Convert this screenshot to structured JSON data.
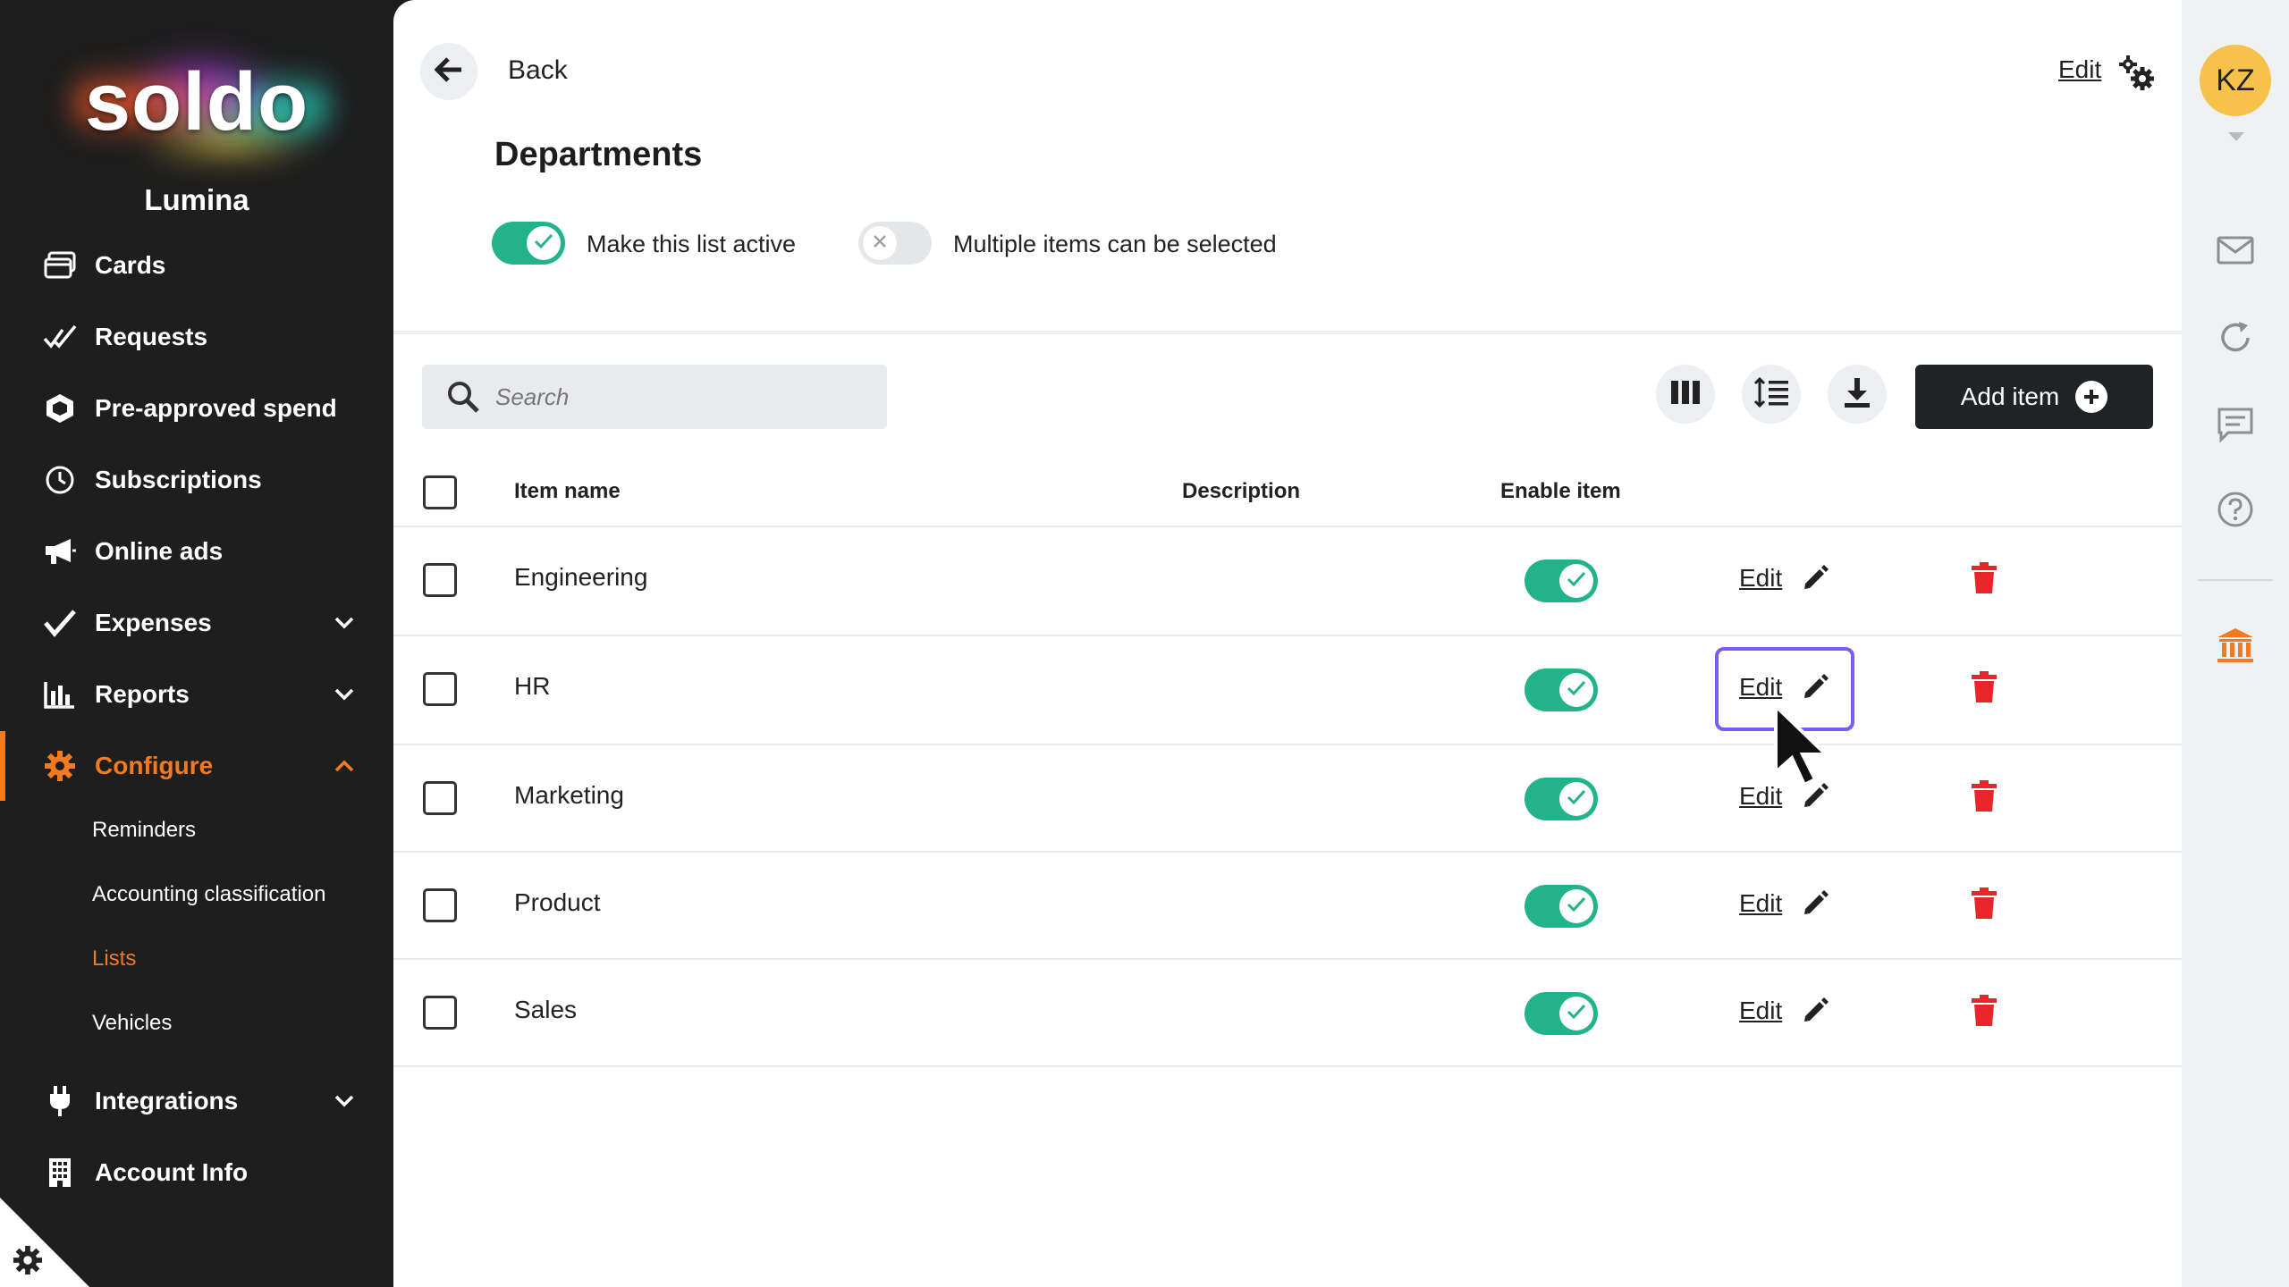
{
  "sidebar": {
    "logo_text": "soldo",
    "company": "Lumina",
    "items": [
      {
        "label": "Cards",
        "icon": "cards-icon"
      },
      {
        "label": "Requests",
        "icon": "requests-icon"
      },
      {
        "label": "Pre-approved spend",
        "icon": "hexagon-icon"
      },
      {
        "label": "Subscriptions",
        "icon": "clock-icon"
      },
      {
        "label": "Online ads",
        "icon": "megaphone-icon"
      },
      {
        "label": "Expenses",
        "icon": "check-icon"
      },
      {
        "label": "Reports",
        "icon": "bar-chart-icon"
      },
      {
        "label": "Configure",
        "icon": "gear-icon"
      },
      {
        "label": "Integrations",
        "icon": "plug-icon"
      },
      {
        "label": "Account Info",
        "icon": "building-icon"
      }
    ],
    "configure_sub": [
      "Reminders",
      "Accounting classification",
      "Lists",
      "Vehicles"
    ],
    "active_item": "Configure",
    "active_sub": "Lists"
  },
  "header": {
    "back_label": "Back",
    "edit_label": "Edit",
    "title": "Departments"
  },
  "settings": {
    "active_toggle": {
      "label": "Make this list active",
      "on": true
    },
    "multi_toggle": {
      "label": "Multiple items can be selected",
      "on": false
    }
  },
  "toolbar": {
    "search_placeholder": "Search",
    "add_item_label": "Add item"
  },
  "table": {
    "columns": [
      "Item name",
      "Description",
      "Enable item"
    ],
    "edit_label": "Edit",
    "rows": [
      {
        "name": "Engineering",
        "description": "",
        "enabled": true
      },
      {
        "name": "HR",
        "description": "",
        "enabled": true
      },
      {
        "name": "Marketing",
        "description": "",
        "enabled": true
      },
      {
        "name": "Product",
        "description": "",
        "enabled": true
      },
      {
        "name": "Sales",
        "description": "",
        "enabled": true
      }
    ]
  },
  "user": {
    "initials": "KZ"
  },
  "colors": {
    "accent": "#f47a20",
    "toggle_on": "#22b38b",
    "delete": "#e8262a",
    "avatar": "#f6c24a",
    "focus": "#7a5cf0"
  }
}
